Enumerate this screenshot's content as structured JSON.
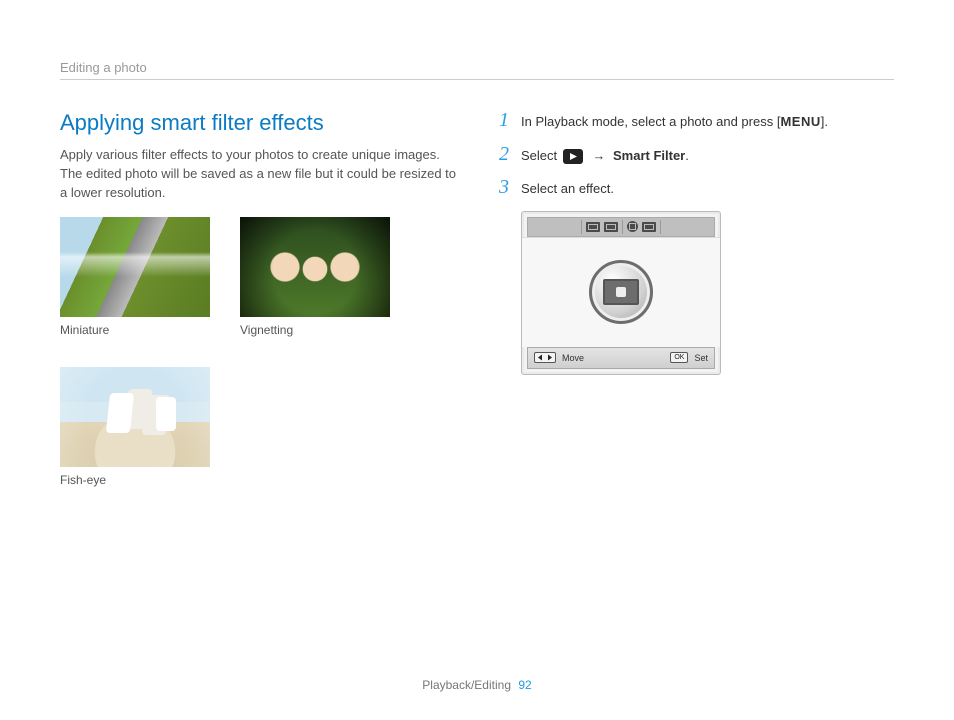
{
  "breadcrumb": "Editing a photo",
  "title": "Applying smart filter effects",
  "intro": "Apply various filter effects to your photos to create unique images. The edited photo will be saved as a new file but it could be resized to a lower resolution.",
  "thumbs": {
    "miniature": "Miniature",
    "vignetting": "Vignetting",
    "fisheye": "Fish-eye"
  },
  "steps": {
    "s1": {
      "num": "1",
      "pre": "In Playback mode, select a photo and press [",
      "menu": "MENU",
      "post": "]."
    },
    "s2": {
      "num": "2",
      "pre": "Select ",
      "arrow": "→",
      "label": "Smart Filter",
      "post": "."
    },
    "s3": {
      "num": "3",
      "text": "Select an effect."
    }
  },
  "camera_ui": {
    "move": "Move",
    "set": "Set",
    "ok": "OK"
  },
  "footer": {
    "section": "Playback/Editing",
    "page": "92"
  }
}
